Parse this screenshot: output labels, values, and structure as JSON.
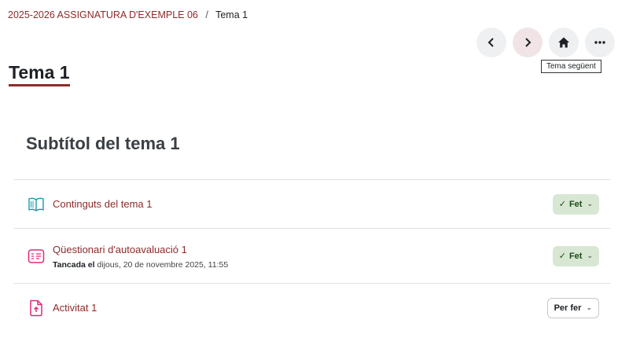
{
  "breadcrumb": {
    "course": "2025-2026 ASSIGNATURA D'EXEMPLE 06",
    "separator": "/",
    "current": "Tema 1"
  },
  "nav": {
    "tooltip": "Tema següent"
  },
  "page": {
    "title": "Tema 1",
    "section_title": "Subtítol del tema 1"
  },
  "activities": [
    {
      "name": "Continguts del tema 1",
      "icon": "book-icon",
      "status": "Fet",
      "meta_label": "",
      "meta_value": ""
    },
    {
      "name": "Qüestionari d'autoavaluació 1",
      "icon": "quiz-icon",
      "status": "Fet",
      "meta_label": "Tancada el",
      "meta_value": "dijous, 20 de novembre 2025, 11:55"
    },
    {
      "name": "Activitat 1",
      "icon": "assignment-upload-icon",
      "status": "Per fer",
      "meta_label": "",
      "meta_value": ""
    }
  ],
  "colors": {
    "accent": "#8e2b2b",
    "done_bg": "#d8e7d3",
    "icon_teal": "#1a9aa8",
    "icon_pink": "#e0297a"
  }
}
